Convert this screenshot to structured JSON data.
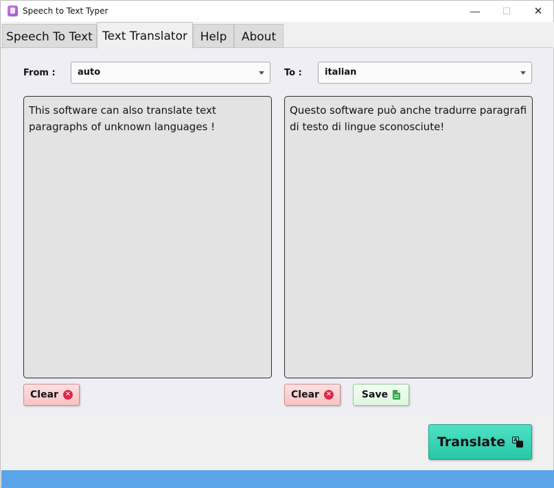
{
  "window": {
    "title": "Speech to Text Typer",
    "minimize_glyph": "—",
    "maximize_glyph": "☐",
    "close_glyph": "✕"
  },
  "tabs": [
    {
      "label": "Speech To Text",
      "active": false
    },
    {
      "label": "Text Translator",
      "active": true
    },
    {
      "label": "Help",
      "active": false
    },
    {
      "label": "About",
      "active": false
    }
  ],
  "translator": {
    "from_label": "From :",
    "from_value": "auto",
    "to_label": "To :",
    "to_value": "italian",
    "source_text": "This software can also translate text paragraphs of unknown languages !",
    "target_text": "Questo software può anche tradurre paragrafi di testo di lingue sconosciute!",
    "clear_left_label": "Clear",
    "clear_right_label": "Clear",
    "save_label": "Save",
    "translate_label": "Translate"
  },
  "icons": {
    "app": "microphone-app-icon",
    "clear": "close-circle-icon",
    "save": "document-icon",
    "translate": "translate-icon"
  },
  "colors": {
    "clear_button": "#f6c3c3",
    "save_button": "#dff5df",
    "translate_button": "#26c7a6",
    "status_bar": "#5aa4ea"
  }
}
